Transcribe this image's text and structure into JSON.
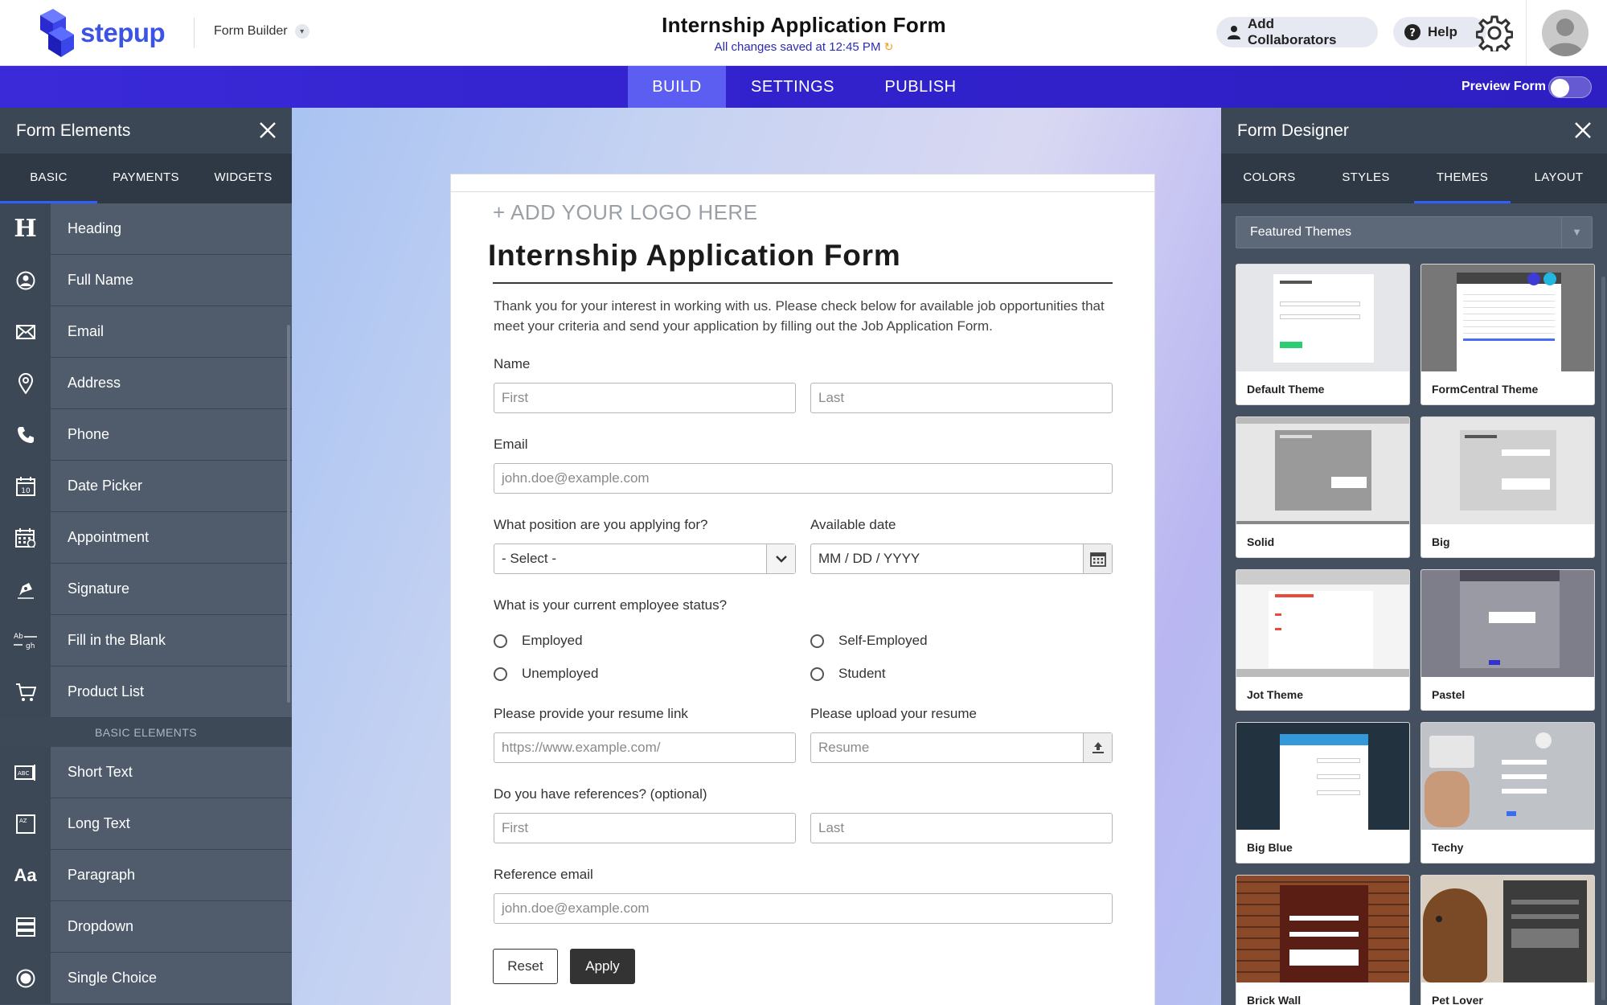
{
  "header": {
    "brand": "stepup",
    "builder_mode": "Form Builder",
    "form_title": "Internship Application Form",
    "save_status": "All changes saved at 12:45 PM",
    "add_collaborators": "Add Collaborators",
    "help": "Help"
  },
  "nav": {
    "build": "BUILD",
    "settings": "SETTINGS",
    "publish": "PUBLISH",
    "preview": "Preview Form"
  },
  "left_panel": {
    "title": "Form Elements",
    "tabs": [
      "BASIC",
      "PAYMENTS",
      "WIDGETS"
    ],
    "items": [
      "Heading",
      "Full Name",
      "Email",
      "Address",
      "Phone",
      "Date Picker",
      "Appointment",
      "Signature",
      "Fill in the Blank",
      "Product List"
    ],
    "section_label": "BASIC ELEMENTS",
    "basic_items": [
      "Short Text",
      "Long Text",
      "Paragraph",
      "Dropdown",
      "Single Choice"
    ]
  },
  "form": {
    "add_logo": "+ ADD YOUR LOGO HERE",
    "title": "Internship Application Form",
    "description": "Thank you for your interest in working with us. Please check below for available job opportunities that meet your criteria and send your application by filling out the Job Application Form.",
    "name_label": "Name",
    "first_placeholder": "First",
    "last_placeholder": "Last",
    "email_label": "Email",
    "email_placeholder": "john.doe@example.com",
    "position_label": "What position are you applying for?",
    "position_value": "- Select -",
    "date_label": "Available date",
    "date_placeholder": "MM / DD / YYYY",
    "status_label": "What is your current employee status?",
    "status_options": [
      "Employed",
      "Self-Employed",
      "Unemployed",
      "Student"
    ],
    "resume_link_label": "Please provide your resume link",
    "resume_link_placeholder": "https://www.example.com/",
    "resume_upload_label": "Please upload your resume",
    "resume_upload_placeholder": "Resume",
    "references_label": "Do you have references? (optional)",
    "ref_first_placeholder": "First",
    "ref_last_placeholder": "Last",
    "ref_email_label": "Reference email",
    "ref_email_placeholder": "john.doe@example.com",
    "reset": "Reset",
    "apply": "Apply"
  },
  "right_panel": {
    "title": "Form Designer",
    "tabs": [
      "COLORS",
      "STYLES",
      "THEMES",
      "LAYOUT"
    ],
    "theme_filter": "Featured Themes",
    "themes": [
      "Default Theme",
      "FormCentral Theme",
      "Solid",
      "Big",
      "Jot Theme",
      "Pastel",
      "Big Blue",
      "Techy",
      "Brick Wall",
      "Pet Lover"
    ]
  },
  "colors": {
    "brand": "#3c54e3",
    "nav_bg": "#3122cc",
    "nav_active": "#5b5ef0",
    "panel_bg": "#44505f",
    "accent_tab": "#2f5fff"
  }
}
